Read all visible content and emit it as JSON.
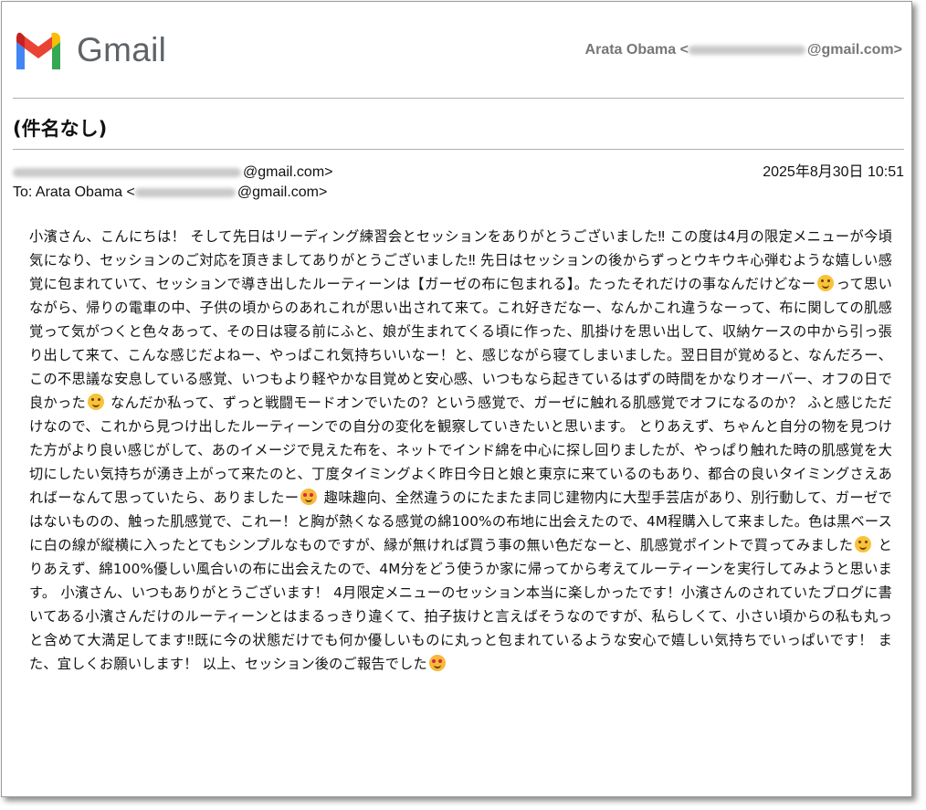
{
  "app": {
    "name": "Gmail",
    "logo_icon": "gmail-m-icon",
    "brand_colors": {
      "red": "#ea4335",
      "blue": "#4285f4",
      "green": "#34a853",
      "yellow": "#fbbc04",
      "dark_red": "#c5221f"
    }
  },
  "account": {
    "name": "Arata Obama",
    "open": "<",
    "domain": "@gmail.com>"
  },
  "email": {
    "subject": "(件名なし)",
    "from_domain": "@gmail.com>",
    "to_prefix": "To: Arata Obama <",
    "to_domain": "@gmail.com>",
    "date": "2025年8月30日 10:51",
    "body": [
      "小濱さん、こんにちは！ そして先日はリーディング練習会とセッションをありがとうございました‼ この度は4月の限定メニューが今頃気になり、セッションのご対応を頂きましてありがとうございました‼ 先日はセッションの後からずっとウキウキ心弾むような嬉しい感覚に包まれていて、セッションで導き出したルーティーンは【ガーゼの布に包まれる】。たったそれだけの事なんだけどなー",
      "って思いながら、帰りの電車の中、子供の頃からのあれこれが思い出されて来て。これ好きだなー、なんかこれ違うなーって、布に関しての肌感覚って気がつくと色々あって、その日は寝る前にふと、娘が生まれてくる頃に作った、肌掛けを思い出して、収納ケースの中から引っ張り出して来て、こんな感じだよねー、やっぱこれ気持ちいいなー！と、感じながら寝てしまいました。翌日目が覚めると、なんだろー、この不思議な安息している感覚、いつもより軽やかな目覚めと安心感、いつもなら起きているはずの時間をかなりオーバー、オフの日で良かった",
      " なんだか私って、ずっと戦闘モードオンでいたの？という感覚で、ガーゼに触れる肌感覚でオフになるのか？ ふと感じただけなので、これから見つけ出したルーティーンでの自分の変化を観察していきたいと思います。 とりあえず、ちゃんと自分の物を見つけた方がより良い感じがして、あのイメージで見えた布を、ネットでインド綿を中心に探し回りましたが、やっぱり触れた時の肌感覚を大切にしたい気持ちが湧き上がって来たのと、丁度タイミングよく昨日今日と娘と東京に来ているのもあり、都合の良いタイミングさえあればーなんて思っていたら、ありましたー",
      " 趣味趣向、全然違うのにたまたま同じ建物内に大型手芸店があり、別行動して、ガーゼではないものの、触った肌感覚で、これー！と胸が熱くなる感覚の綿100%の布地に出会えたので、4M程購入して来ました。色は黒ベースに白の線が縦横に入ったとてもシンプルなものですが、縁が無ければ買う事の無い色だなーと、肌感覚ポイントで買ってみました",
      " とりあえず、綿100%優しい風合いの布に出会えたので、4M分をどう使うか家に帰ってから考えてルーティーンを実行してみようと思います。 小濱さん、いつもありがとうございます！ 4月限定メニューのセッション本当に楽しかったです！小濱さんのされていたブログに書いてある小濱さんだけのルーティーンとはまるっきり違くて、拍子抜けと言えばそうなのですが、私らしくて、小さい頃からの私も丸っと含めて大満足してます‼既に今の状態だけでも何か優しいものに丸っと包まれているような安心で嬉しい気持ちでいっぱいです！ また、宜しくお願いします！ 以上、セッション後のご報告でした"
    ],
    "emoji_icons": [
      "smiling-face-icon",
      "grinning-face-icon",
      "smiling-face-with-hearts-icon",
      "smiling-face-icon",
      "smiling-face-with-hearts-icon"
    ]
  }
}
